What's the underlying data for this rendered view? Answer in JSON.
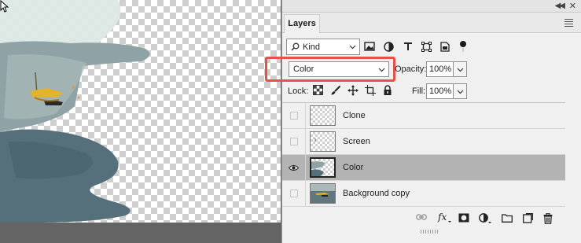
{
  "panel": {
    "tab_label": "Layers",
    "filter": {
      "kind_label": "Kind"
    },
    "blend": {
      "mode": "Color",
      "opacity_label": "Opacity:",
      "opacity_value": "100%"
    },
    "lock": {
      "label": "Lock:",
      "fill_label": "Fill:",
      "fill_value": "100%"
    },
    "layers": [
      {
        "name": "Clone",
        "visible": false,
        "selected": false
      },
      {
        "name": "Screen",
        "visible": false,
        "selected": false
      },
      {
        "name": "Color",
        "visible": true,
        "selected": true
      },
      {
        "name": "Background copy",
        "visible": false,
        "selected": false
      }
    ],
    "highlight_color": "#e8504a"
  }
}
